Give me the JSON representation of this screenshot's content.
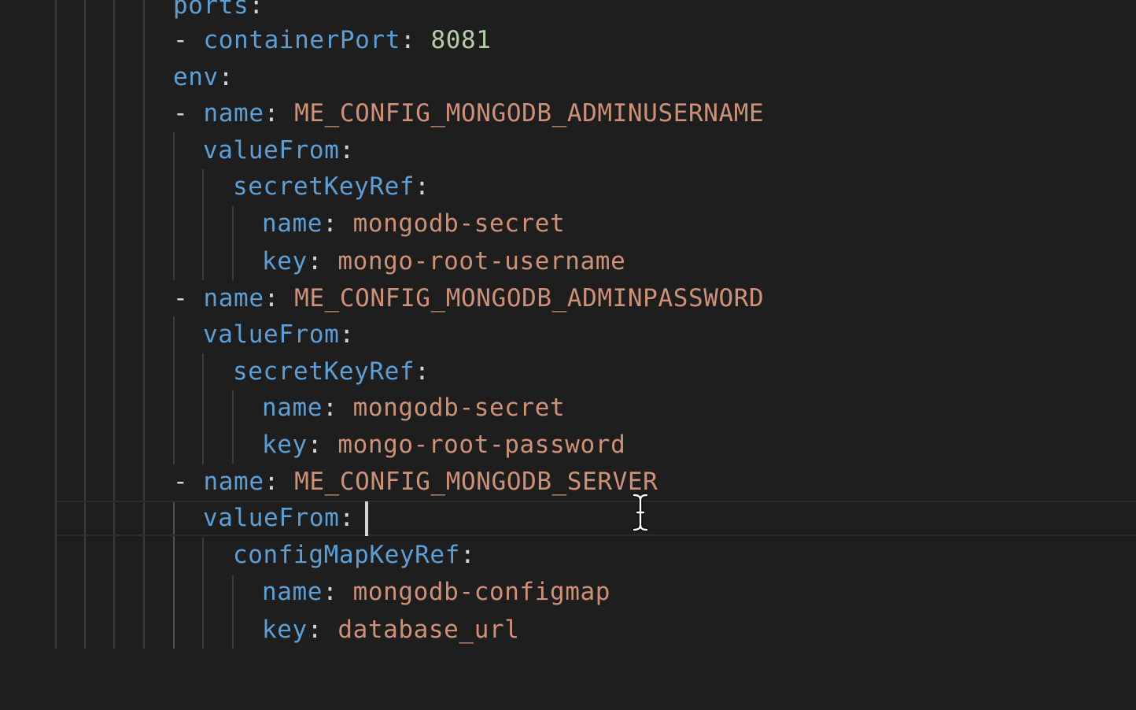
{
  "editor": {
    "lines": [
      [
        {
          "t": "ports",
          "c": "k"
        },
        {
          "t": ":",
          "c": "p"
        }
      ],
      [
        {
          "t": "- ",
          "c": "p"
        },
        {
          "t": "containerPort",
          "c": "k"
        },
        {
          "t": ": ",
          "c": "p"
        },
        {
          "t": "8081",
          "c": "n"
        }
      ],
      [
        {
          "t": "env",
          "c": "k"
        },
        {
          "t": ":",
          "c": "p"
        }
      ],
      [
        {
          "t": "- ",
          "c": "p"
        },
        {
          "t": "name",
          "c": "k"
        },
        {
          "t": ": ",
          "c": "p"
        },
        {
          "t": "ME_CONFIG_MONGODB_ADMINUSERNAME",
          "c": "s"
        }
      ],
      [
        {
          "t": "valueFrom",
          "c": "k"
        },
        {
          "t": ":",
          "c": "p"
        }
      ],
      [
        {
          "t": "secretKeyRef",
          "c": "k"
        },
        {
          "t": ":",
          "c": "p"
        }
      ],
      [
        {
          "t": "name",
          "c": "k"
        },
        {
          "t": ": ",
          "c": "p"
        },
        {
          "t": "mongodb-secret",
          "c": "s"
        }
      ],
      [
        {
          "t": "key",
          "c": "k"
        },
        {
          "t": ": ",
          "c": "p"
        },
        {
          "t": "mongo-root-username",
          "c": "s"
        }
      ],
      [
        {
          "t": "- ",
          "c": "p"
        },
        {
          "t": "name",
          "c": "k"
        },
        {
          "t": ": ",
          "c": "p"
        },
        {
          "t": "ME_CONFIG_MONGODB_ADMINPASSWORD",
          "c": "s"
        }
      ],
      [
        {
          "t": "valueFrom",
          "c": "k"
        },
        {
          "t": ":",
          "c": "p"
        }
      ],
      [
        {
          "t": "secretKeyRef",
          "c": "k"
        },
        {
          "t": ":",
          "c": "p"
        }
      ],
      [
        {
          "t": "name",
          "c": "k"
        },
        {
          "t": ": ",
          "c": "p"
        },
        {
          "t": "mongodb-secret",
          "c": "s"
        }
      ],
      [
        {
          "t": "key",
          "c": "k"
        },
        {
          "t": ": ",
          "c": "p"
        },
        {
          "t": "mongo-root-password",
          "c": "s"
        }
      ],
      [
        {
          "t": "- ",
          "c": "p"
        },
        {
          "t": "name",
          "c": "k"
        },
        {
          "t": ": ",
          "c": "p"
        },
        {
          "t": "ME_CONFIG_MONGODB_SERVER",
          "c": "s"
        }
      ],
      [
        {
          "t": "valueFrom",
          "c": "k"
        },
        {
          "t": ": ",
          "c": "p"
        }
      ],
      [
        {
          "t": "configMapKeyRef",
          "c": "k"
        },
        {
          "t": ":",
          "c": "p"
        }
      ],
      [
        {
          "t": "name",
          "c": "k"
        },
        {
          "t": ": ",
          "c": "p"
        },
        {
          "t": "mongodb-configmap",
          "c": "s"
        }
      ],
      [
        {
          "t": "key",
          "c": "k"
        },
        {
          "t": ": ",
          "c": "p"
        },
        {
          "t": "database_url",
          "c": "s"
        }
      ]
    ]
  },
  "colors": {
    "background": "#1e1e1e",
    "key": "#5c9fd6",
    "string": "#ce9178",
    "number": "#b5cea8",
    "punctuation": "#d4d4d4"
  }
}
